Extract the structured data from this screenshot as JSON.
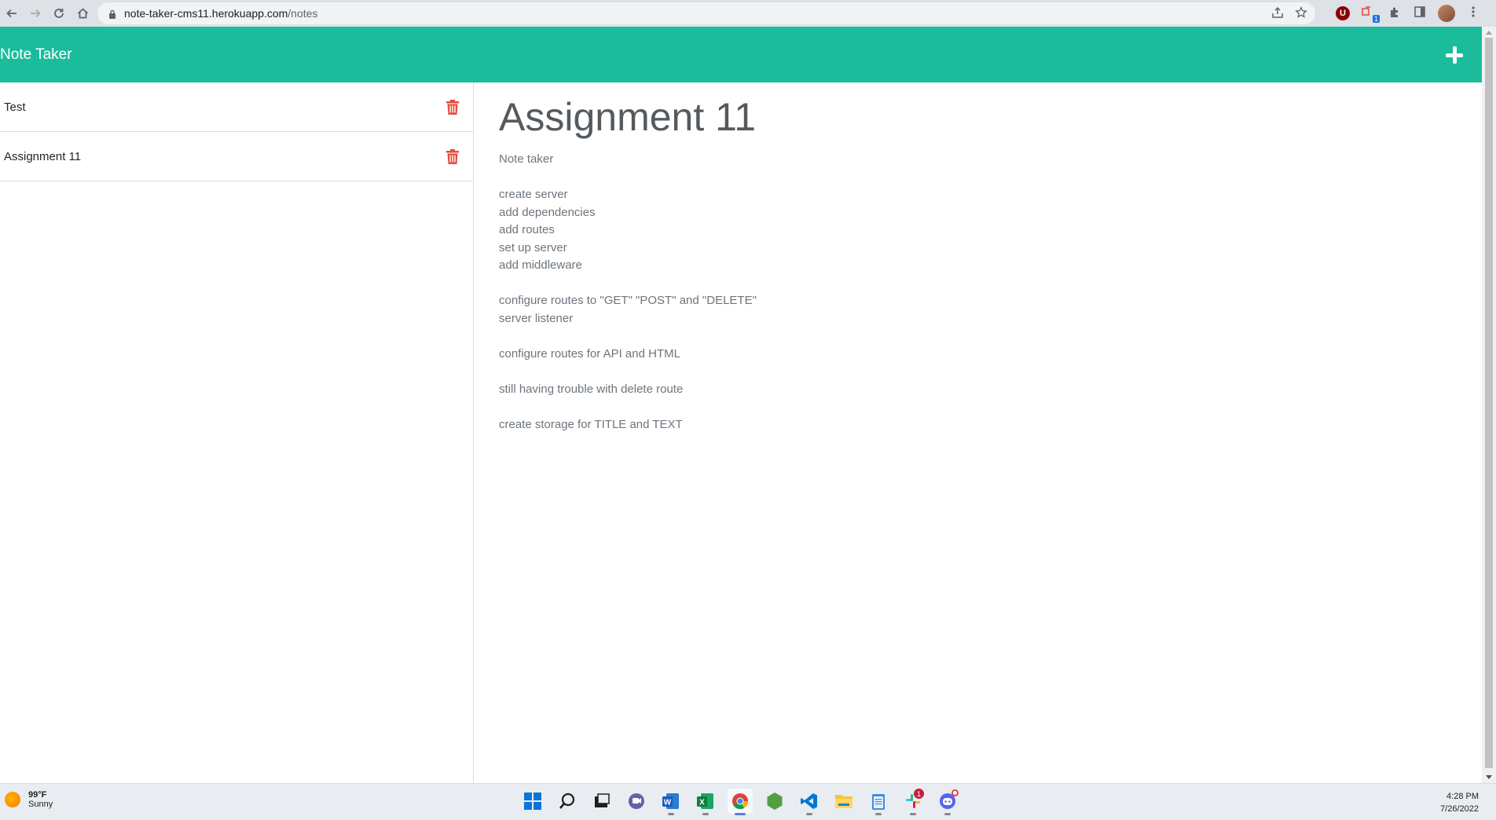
{
  "browser": {
    "url_host": "note-taker-cms11.herokuapp.com",
    "url_path": "/notes",
    "extension_badge_count": "1",
    "extension_u_letter": "U",
    "icons": [
      "back-arrow-icon",
      "forward-arrow-icon",
      "reload-icon",
      "home-icon",
      "lock-icon",
      "share-icon",
      "star-icon",
      "extensions-icon",
      "sidepanel-icon",
      "kebab-menu-icon"
    ]
  },
  "header": {
    "title": "Note Taker",
    "accent_color": "#1abc9c"
  },
  "sidebar": {
    "items": [
      {
        "title": "Test"
      },
      {
        "title": "Assignment 11"
      }
    ],
    "delete_icon_color": "#e74c3c"
  },
  "note": {
    "title": "Assignment 11",
    "text": "Note taker\n\ncreate server\nadd dependencies\nadd routes\nset up server\nadd middleware\n\nconfigure routes to \"GET\" \"POST\" and \"DELETE\"\nserver listener\n\nconfigure routes for API and HTML\n\nstill having trouble with delete route\n\ncreate storage for TITLE and TEXT"
  },
  "taskbar": {
    "weather_temp": "99°F",
    "weather_desc": "Sunny",
    "time": "4:28 PM",
    "date": "7/26/2022",
    "slack_badge": "1",
    "apps": [
      "windows-start-icon",
      "search-icon",
      "task-view-icon",
      "teams-chat-icon",
      "word-icon",
      "excel-icon",
      "chrome-icon",
      "nodejs-icon",
      "vscode-icon",
      "file-explorer-icon",
      "notepad-icon",
      "slack-icon",
      "discord-icon"
    ]
  }
}
